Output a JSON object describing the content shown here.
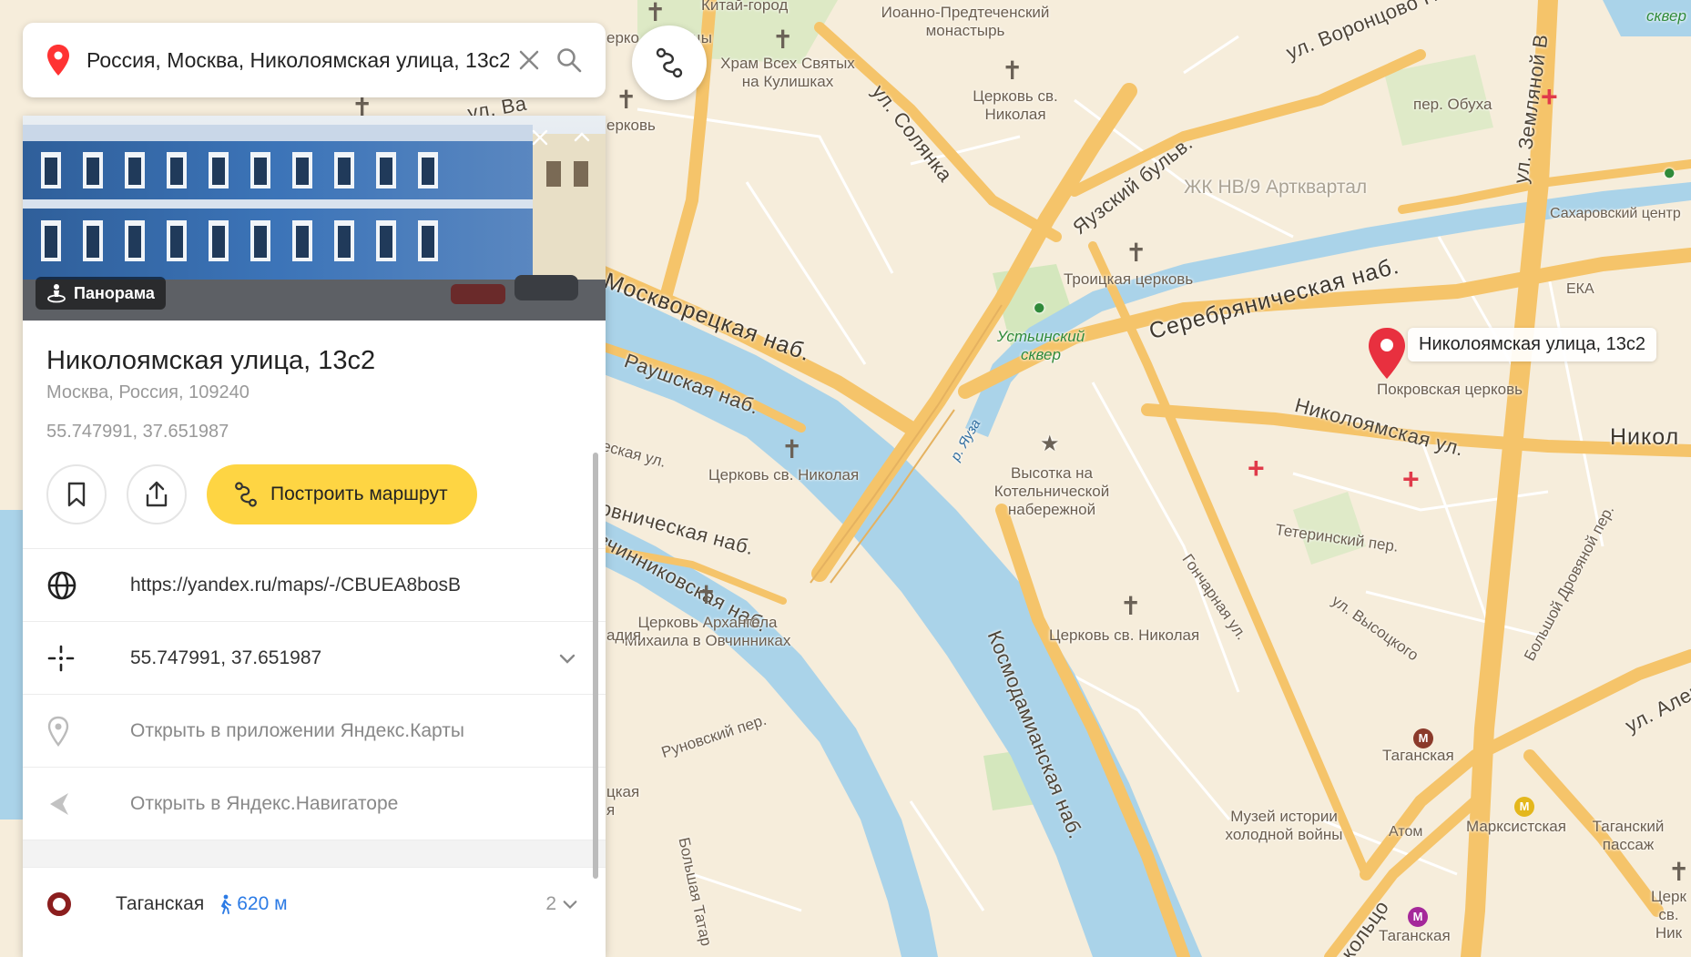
{
  "search": {
    "value": "Россия, Москва, Николоямская улица, 13с2"
  },
  "panorama": {
    "label": "Панорама"
  },
  "place": {
    "title": "Николоямская улица, 13с2",
    "address": "Москва, Россия, 109240",
    "coords": "55.747991, 37.651987"
  },
  "actions": {
    "route_label": "Построить маршрут"
  },
  "rows": {
    "link": "https://yandex.ru/maps/-/CBUEA8bosB",
    "coords": "55.747991, 37.651987",
    "open_app": "Открыть в приложении Яндекс.Карты",
    "open_navigator": "Открыть в Яндекс.Навигаторе"
  },
  "metro": {
    "name": "Таганская",
    "distance": "620 м",
    "count": "2"
  },
  "map": {
    "marker_label": "Николоямская улица, 13с2",
    "labels": {
      "kitay_gorod": "Китай-город",
      "ioanno": "Иоанно-Предтеченский монастырь",
      "khram": "Храм Всех Святых на Кулишках",
      "church_nikolaya_top": "Церковь св. Николая",
      "solyanka": "ул. Солянка",
      "vorontsovo": "ул. Воронцово По...",
      "obukha": "пер. Обуха",
      "zemlyanoy": "ул. Земляной В",
      "sakharovsky": "Сахаровский центр",
      "yauzsky": "Яузский бульв.",
      "zhk": "ЖК НВ/9 Артквартал",
      "troitskaya": "Троицкая церковь",
      "serebryanicheskaya": "Серебряническая наб.",
      "eka": "ЕКА",
      "moskvoretskaya": "Москворецкая наб.",
      "raushskaya": "Раушская наб.",
      "ustinsky": "Устьинский сквер",
      "yauza": "р. Яуза",
      "pokrovskaya": "Покровская церковь",
      "nikoloyamskaya_ul": "Николоямская ул.",
      "nikol_right": "Никол",
      "church_nikolaya_mid": "Церковь св. Николая",
      "vysotka": "Высотка на Котельнической набережной",
      "teterinsky": "Тетеринский пер.",
      "ovchinnikovskaya_1": "овническая наб.",
      "ovchinnikovskaya_2": "вчинниковская наб.",
      "church_mikhaila": "Церковь Архангела Михаила в Овчинниках",
      "goncharnaya": "Гончарная ул.",
      "vysotskogo": "ул. Высоцкого",
      "droviannoy": "Большой Дровяной пер.",
      "church_nikolaya_low": "Церковь св. Николая",
      "kosmodamianskaya": "Космодамианская наб.",
      "runovsky": "Руновский пер.",
      "taganskaya_top": "Таганская",
      "aleks": "ул. Алекс",
      "muzey": "Музей истории холодной войны",
      "atom": "Атом",
      "marksistskaya": "Марксистская",
      "tagansky_passage": "Таганский пассаж",
      "tserk_right": "Церк св. Ник",
      "taganskaya_bottom": "Таганская",
      "koltso": "кольцо",
      "bolshaya_tatar": "Большая Татар",
      "skaya_left": "цкая",
      "ya_left": "я",
      "eskaya_ul": "еская ул.",
      "adiya": "адия",
      "skver_top": "сквер",
      "ul_val": "ул. Ва",
      "cerk_top_left": "ерковь",
      "chy": "цы",
      "erko": "ерко"
    }
  },
  "colors": {
    "accent_yellow": "#fed543",
    "marker_red": "#e8303f",
    "water": "#aad3e9",
    "road": "#f5c46a",
    "metro_red": "#8b1e1e",
    "link_blue": "#2c7be5"
  }
}
